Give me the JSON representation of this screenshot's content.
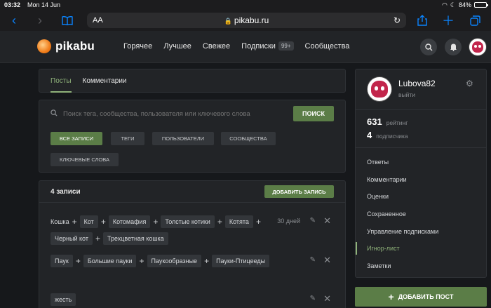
{
  "status": {
    "time": "03:32",
    "date": "Mon 14 Jun",
    "battery": "84%",
    "battery_level": 0.84
  },
  "browser": {
    "text_size_label": "AA",
    "url": "pikabu.ru"
  },
  "header": {
    "logo": "pikabu",
    "nav": [
      "Горячее",
      "Лучшее",
      "Свежее",
      "Подписки",
      "Сообщества"
    ],
    "subs_badge": "99+"
  },
  "tabs": [
    "Посты",
    "Комментарии"
  ],
  "search": {
    "placeholder": "Поиск тега, сообщества, пользователя или ключевого слова",
    "button": "ПОИСК",
    "filters": [
      "ВСЕ ЗАПИСИ",
      "ТЕГИ",
      "ПОЛЬЗОВАТЕЛИ",
      "СООБЩЕСТВА",
      "КЛЮЧЕВЫЕ СЛОВА"
    ]
  },
  "records": {
    "count_label": "4 записи",
    "add_button": "ДОБАВИТЬ ЗАПИСЬ",
    "rows": [
      {
        "lead": "Кошка",
        "tags": [
          "Кот",
          "Котомафия",
          "Толстые котики",
          "Котята",
          "Черный кот",
          "Трехцветная кошка"
        ],
        "date": "30 дней"
      },
      {
        "tags": [
          "Паук",
          "Большие пауки",
          "Паукообразные",
          "Пауки-Птицееды"
        ]
      },
      {
        "tags": [
          "жесть"
        ]
      }
    ]
  },
  "sidebar": {
    "username": "Lubova82",
    "logout": "выйти",
    "rating_num": "631",
    "rating_label": "рейтинг",
    "subs_num": "4",
    "subs_label": "подписчика",
    "menu": [
      "Ответы",
      "Комментарии",
      "Оценки",
      "Сохраненное",
      "Управление подписками",
      "Игнор-лист",
      "Заметки"
    ],
    "active_menu": "Игнор-лист",
    "add_post": "ДОБАВИТЬ ПОСТ"
  },
  "colors": {
    "accent": "#5b7d47",
    "accent_text": "#8fb27a",
    "background": "#16181b",
    "panel": "#222427"
  }
}
